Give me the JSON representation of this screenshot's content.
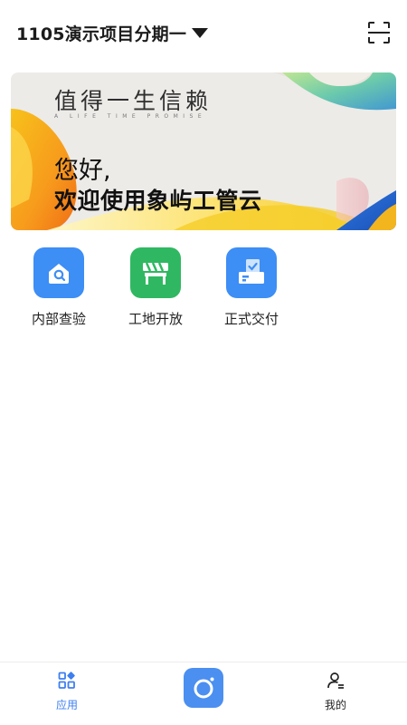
{
  "header": {
    "project_name": "1105演示项目分期一",
    "dropdown_icon": "caret-down-icon",
    "scan_icon": "scan-icon"
  },
  "banner": {
    "title": "值得一生信赖",
    "subtitle": "A LIFE TIME PROMISE",
    "greeting": "您好,",
    "welcome": "欢迎使用象屿工管云"
  },
  "apps": [
    {
      "label": "内部查验",
      "icon": "house-search-icon",
      "color": "#3d8ef5"
    },
    {
      "label": "工地开放",
      "icon": "site-barrier-icon",
      "color": "#2fb861"
    },
    {
      "label": "正式交付",
      "icon": "delivery-check-icon",
      "color": "#3d8ef5"
    }
  ],
  "bottom_nav": {
    "items": [
      {
        "label": "应用",
        "icon": "apps-grid-icon",
        "active": true
      },
      {
        "label": "我的",
        "icon": "user-icon",
        "active": false
      }
    ],
    "camera_icon": "camera-icon"
  },
  "colors": {
    "accent": "#4b8ff0",
    "active_nav": "#3d7ff0",
    "text": "#1b1b1b"
  }
}
